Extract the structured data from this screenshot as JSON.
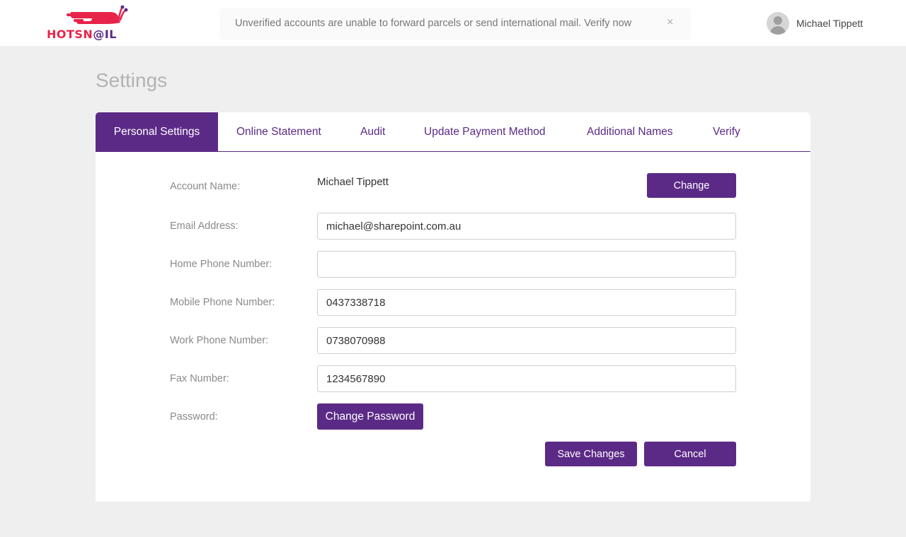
{
  "brand": {
    "logo_hot": "HOTSN",
    "logo_at": "@",
    "logo_il": "IL",
    "primary_color": "#5b2a86",
    "accent_color": "#e8234a"
  },
  "notice": {
    "text": "Unverified accounts are unable to forward parcels or send international mail. Verify now",
    "close_label": "×"
  },
  "user": {
    "name": "Michael Tippett",
    "avatar_icon": "user-avatar-icon"
  },
  "page": {
    "title": "Settings"
  },
  "tabs": [
    {
      "label": "Personal Settings",
      "active": true
    },
    {
      "label": "Online Statement",
      "active": false
    },
    {
      "label": "Audit",
      "active": false
    },
    {
      "label": "Update Payment Method",
      "active": false
    },
    {
      "label": "Additional Names",
      "active": false
    },
    {
      "label": "Verify",
      "active": false
    }
  ],
  "form": {
    "account_name": {
      "label": "Account Name:",
      "value": "Michael Tippett",
      "button": "Change"
    },
    "email": {
      "label": "Email Address:",
      "value": "michael@sharepoint.com.au"
    },
    "home_phone": {
      "label": "Home Phone Number:",
      "value": ""
    },
    "mobile_phone": {
      "label": "Mobile Phone Number:",
      "value": "0437338718"
    },
    "work_phone": {
      "label": "Work Phone Number:",
      "value": "0738070988"
    },
    "fax": {
      "label": "Fax Number:",
      "value": "1234567890"
    },
    "password": {
      "label": "Password:",
      "button": "Change Password"
    }
  },
  "actions": {
    "save": "Save Changes",
    "cancel": "Cancel"
  }
}
